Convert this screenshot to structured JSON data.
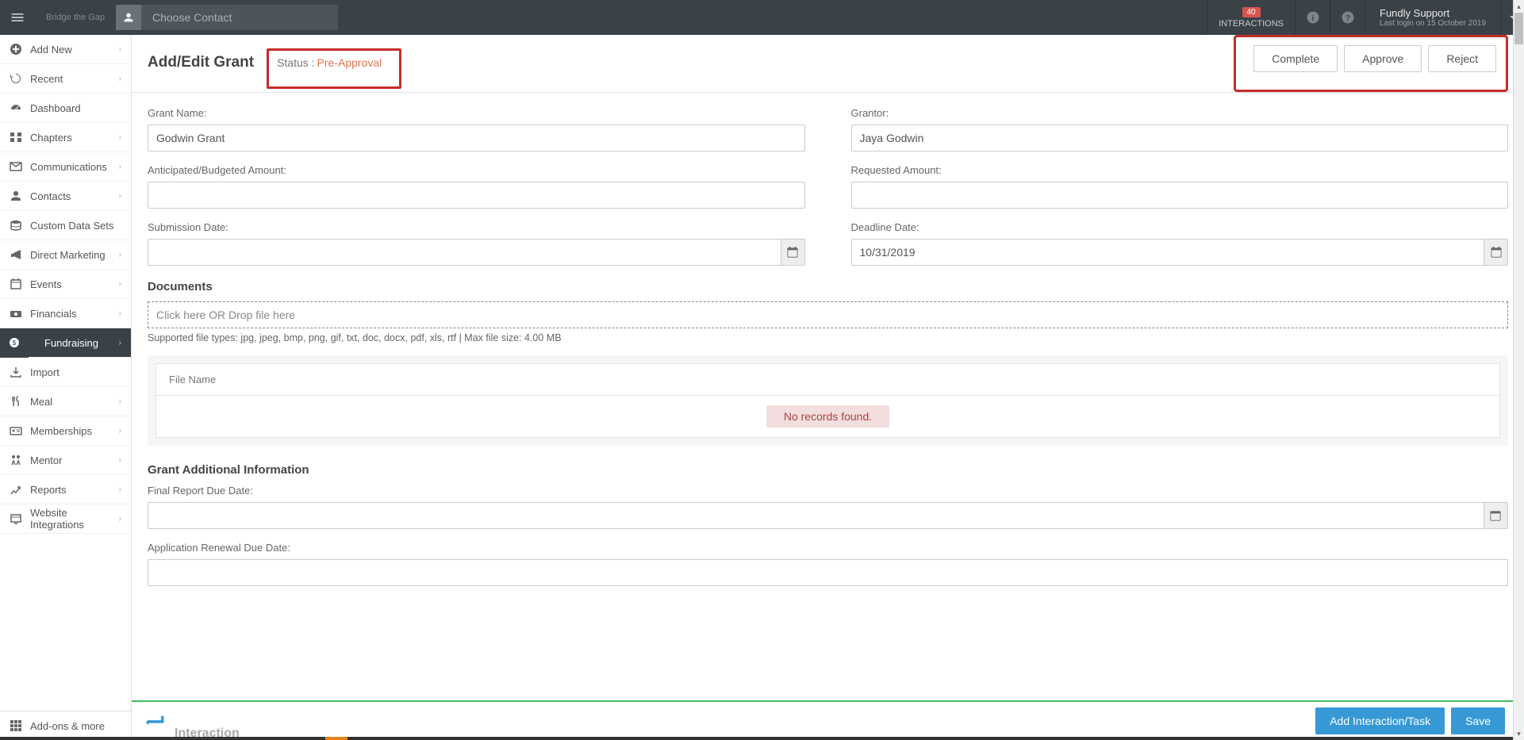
{
  "header": {
    "brand": "Bridge the Gap",
    "contact_placeholder": "Choose Contact",
    "interactions_count": "40",
    "interactions_label": "INTERACTIONS",
    "user_name": "Fundly Support",
    "last_login": "Last login on 15 October 2019"
  },
  "sidebar": {
    "items": [
      "Add New",
      "Recent",
      "Dashboard",
      "Chapters",
      "Communications",
      "Contacts",
      "Custom Data Sets",
      "Direct Marketing",
      "Events",
      "Financials",
      "Fundraising",
      "Import",
      "Meal",
      "Memberships",
      "Mentor",
      "Reports",
      "Website Integrations"
    ],
    "footer": "Add-ons & more"
  },
  "page": {
    "title": "Add/Edit Grant",
    "status_label": "Status :",
    "status_value": "Pre-Approval",
    "actions": {
      "complete": "Complete",
      "approve": "Approve",
      "reject": "Reject"
    }
  },
  "form": {
    "grant_name_label": "Grant Name:",
    "grant_name_value": "Godwin Grant",
    "grantor_label": "Grantor:",
    "grantor_value": "Jaya Godwin",
    "anticipated_label": "Anticipated/Budgeted Amount:",
    "anticipated_value": "",
    "requested_label": "Requested Amount:",
    "requested_value": "",
    "submission_label": "Submission Date:",
    "submission_value": "",
    "deadline_label": "Deadline Date:",
    "deadline_value": "10/31/2019"
  },
  "documents": {
    "section_title": "Documents",
    "dropzone": "Click here OR Drop file here",
    "file_types": "Supported file types: jpg, jpeg, bmp, png, gif, txt, doc, docx, pdf, xls, rtf | Max file size: 4.00 MB",
    "column_header": "File Name",
    "no_records": "No records found."
  },
  "additional": {
    "section_title": "Grant Additional Information",
    "final_report_label": "Final Report Due Date:",
    "final_report_value": "",
    "renewal_label": "Application Renewal Due Date:",
    "renewal_value": ""
  },
  "bottombar": {
    "interaction_label": "Interaction",
    "add_interaction": "Add Interaction/Task",
    "save": "Save"
  }
}
